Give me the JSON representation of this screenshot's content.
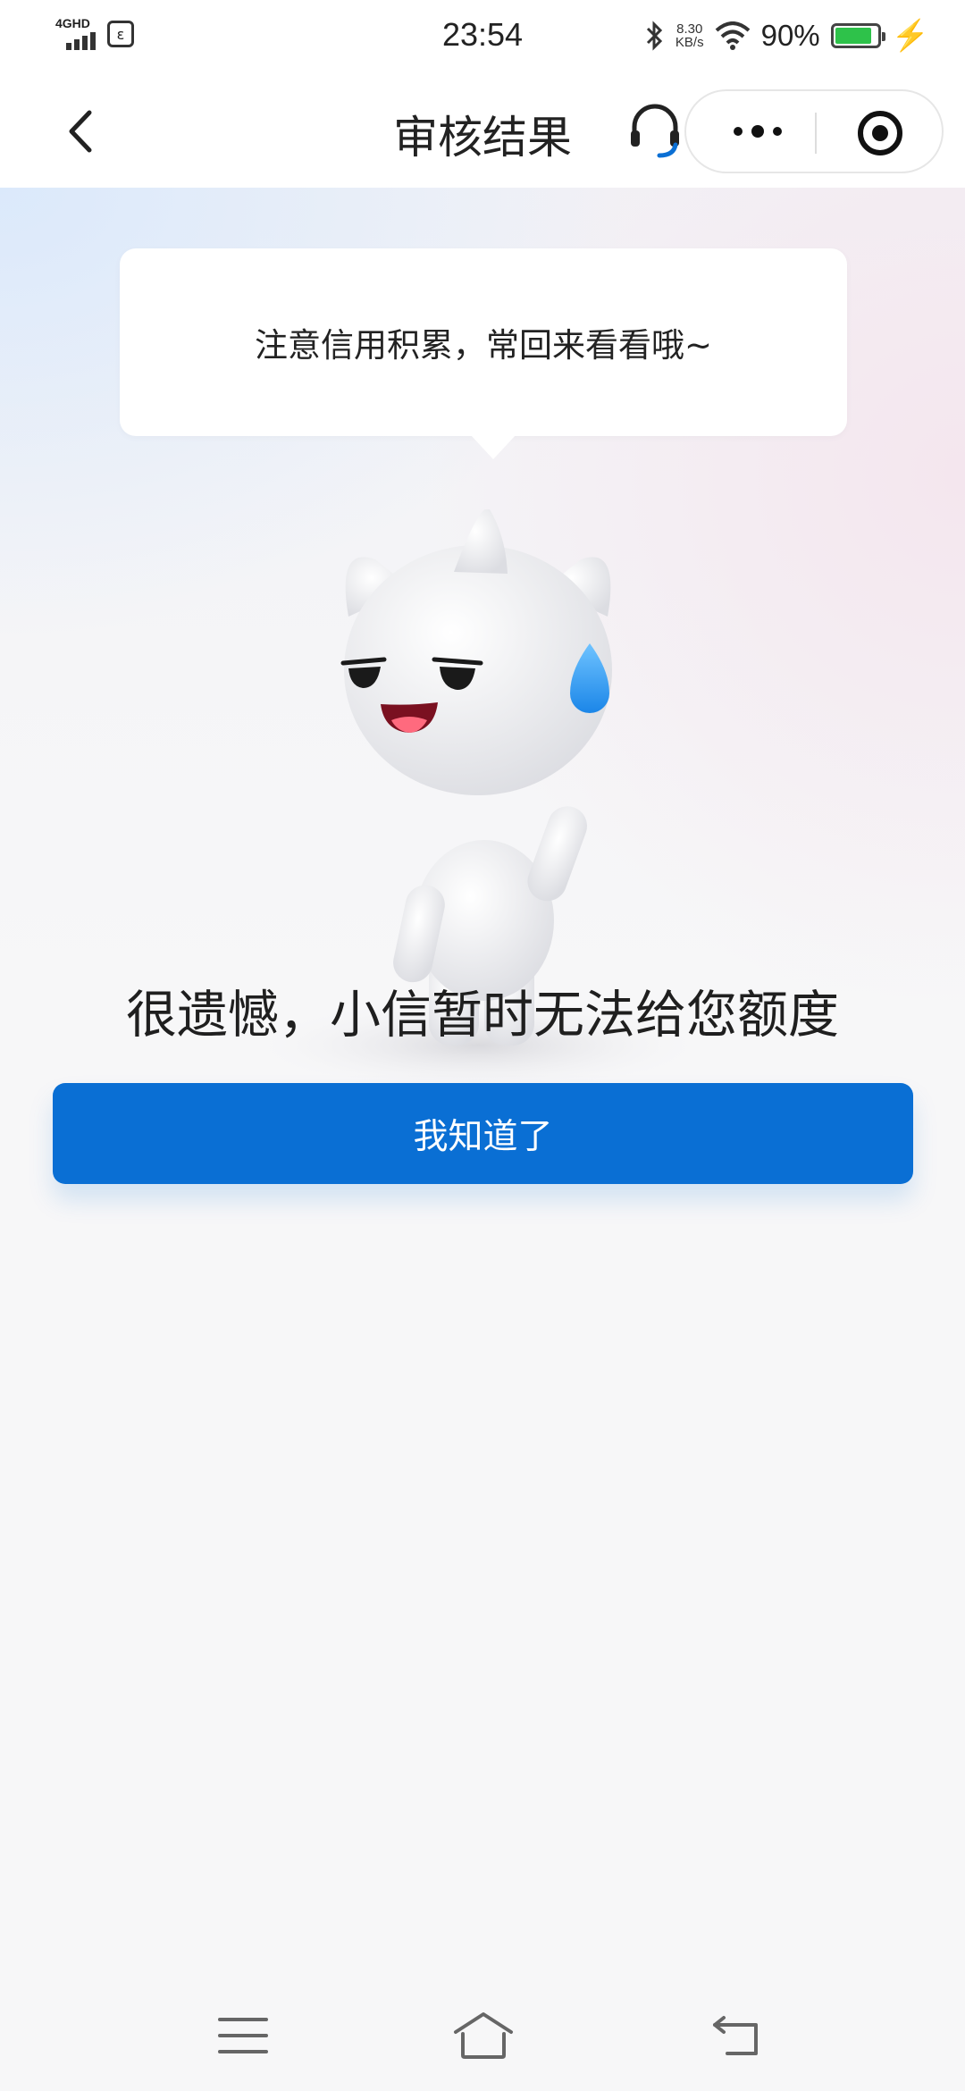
{
  "status_bar": {
    "network": "4GHD",
    "time": "23:54",
    "speed_value": "8.30",
    "speed_unit": "KB/s",
    "battery": "90%"
  },
  "nav": {
    "title": "审核结果"
  },
  "bubble": {
    "text": "注意信用积累，常回来看看哦~"
  },
  "result": {
    "title": "很遗憾，小信暂时无法给您额度"
  },
  "button": {
    "label": "我知道了"
  },
  "colors": {
    "primary": "#0a6fd4",
    "battery": "#2ec24a"
  },
  "icons": [
    "back-arrow-icon",
    "headset-icon",
    "more-dots-icon",
    "target-icon",
    "menu-icon",
    "home-icon",
    "return-icon",
    "bluetooth-icon",
    "wifi-icon",
    "battery-icon",
    "charging-icon"
  ]
}
